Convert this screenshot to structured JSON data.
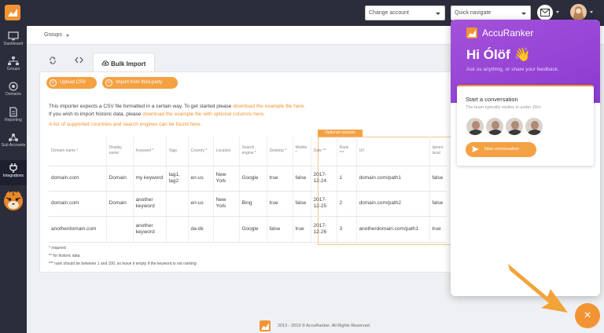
{
  "sidebar": {
    "items": [
      {
        "label": "Dashboard",
        "icon": "monitor-icon"
      },
      {
        "label": "Groups",
        "icon": "sitemap-icon"
      },
      {
        "label": "Domains",
        "icon": "globe-icon"
      },
      {
        "label": "Reporting",
        "icon": "report-icon"
      },
      {
        "label": "Sub Accounts",
        "icon": "share-icon"
      },
      {
        "label": "Integrations",
        "icon": "plug-icon"
      }
    ]
  },
  "topbar": {
    "change_account": "Change account",
    "quick_navigate": "Quick navigate"
  },
  "breadcrumb": {
    "label": "Groups"
  },
  "tabs": {
    "active": "Bulk Import"
  },
  "buttons": {
    "upload_csv": "Upload CSV",
    "import_third_party": "Import from third-party"
  },
  "intro": {
    "line1_pre": "This importer expects a CSV file formatted in a certain way. To get started please ",
    "line1_link": "download the example file here.",
    "line2_pre": "If you wish to import historic data, please ",
    "line2_link": "download the example file with optional columns here.",
    "line3_link": "A list of supported countries and search engines can be found here."
  },
  "optional_label": "Optional columns",
  "table": {
    "headers": [
      "Domain name *",
      "Display name",
      "Keyword *",
      "Tags",
      "Country *",
      "Location",
      "Search engine *",
      "Desktop *",
      "Mobile *",
      "Date **",
      "Rank ***",
      "Url",
      "Ignore local"
    ],
    "rows": [
      [
        "domain.com",
        "Domain",
        "my keyword",
        "tag1, tag2",
        "en-us",
        "New York",
        "Google",
        "true",
        "false",
        "2017-12-24",
        "1",
        "domain.com/path1",
        "false"
      ],
      [
        "domain.com",
        "Domain",
        "another keyword",
        "",
        "en-us",
        "New York",
        "Bing",
        "true",
        "false",
        "2017-12-25",
        "2",
        "domain.com/path2",
        "false"
      ],
      [
        "anotherdomain.com",
        "",
        "another keyword",
        "",
        "da-dk",
        "",
        "Google",
        "false",
        "true",
        "2017-12-26",
        "3",
        "anotherdomain.com/path1",
        "true"
      ]
    ]
  },
  "footnotes": [
    "* required",
    "** for historic data",
    "*** rank should be between 1 and 100, so leave it empty if the keyword is not ranking"
  ],
  "footer": {
    "copyright": "2013 - 2019 © AccuRanker. All Rights Reserved."
  },
  "chat": {
    "brand": "AccuRanker",
    "greeting": "Hi Ólöf 👋",
    "subtitle": "Ask us anything, or share your feedback.",
    "start_title": "Start a conversation",
    "reply_time": "The team typically replies in under 20m",
    "new_conversation": "New conversation",
    "close_symbol": "×"
  },
  "colors": {
    "accent": "#f29434",
    "sidebar": "#2b2d3b",
    "chat_header": "#9a47d6"
  }
}
